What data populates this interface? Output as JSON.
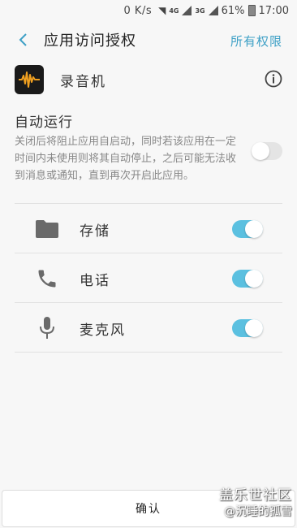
{
  "status_bar": {
    "net_speed": "0 K/s",
    "net1": "4G",
    "net2": "3G",
    "battery": "61%",
    "time": "17:00"
  },
  "header": {
    "title": "应用访问授权",
    "all_permissions": "所有权限"
  },
  "app": {
    "name": "录音机"
  },
  "auto_run": {
    "title": "自动运行",
    "description": "关闭后将阻止应用自启动，同时若该应用在一定时间内未使用则将其自动停止，之后可能无法收到消息或通知，直到再次开启此应用。",
    "enabled": false
  },
  "permissions": [
    {
      "label": "存储",
      "icon": "folder-icon",
      "enabled": true
    },
    {
      "label": "电话",
      "icon": "phone-icon",
      "enabled": true
    },
    {
      "label": "麦克风",
      "icon": "microphone-icon",
      "enabled": true
    }
  ],
  "confirm_label": "确认",
  "watermark": {
    "line1": "盖乐世社区",
    "line2": "@沉睡的孤雪"
  },
  "colors": {
    "accent": "#3ea0c6",
    "toggle_on": "#5bc0e0",
    "toggle_off": "#e4e4e4"
  }
}
